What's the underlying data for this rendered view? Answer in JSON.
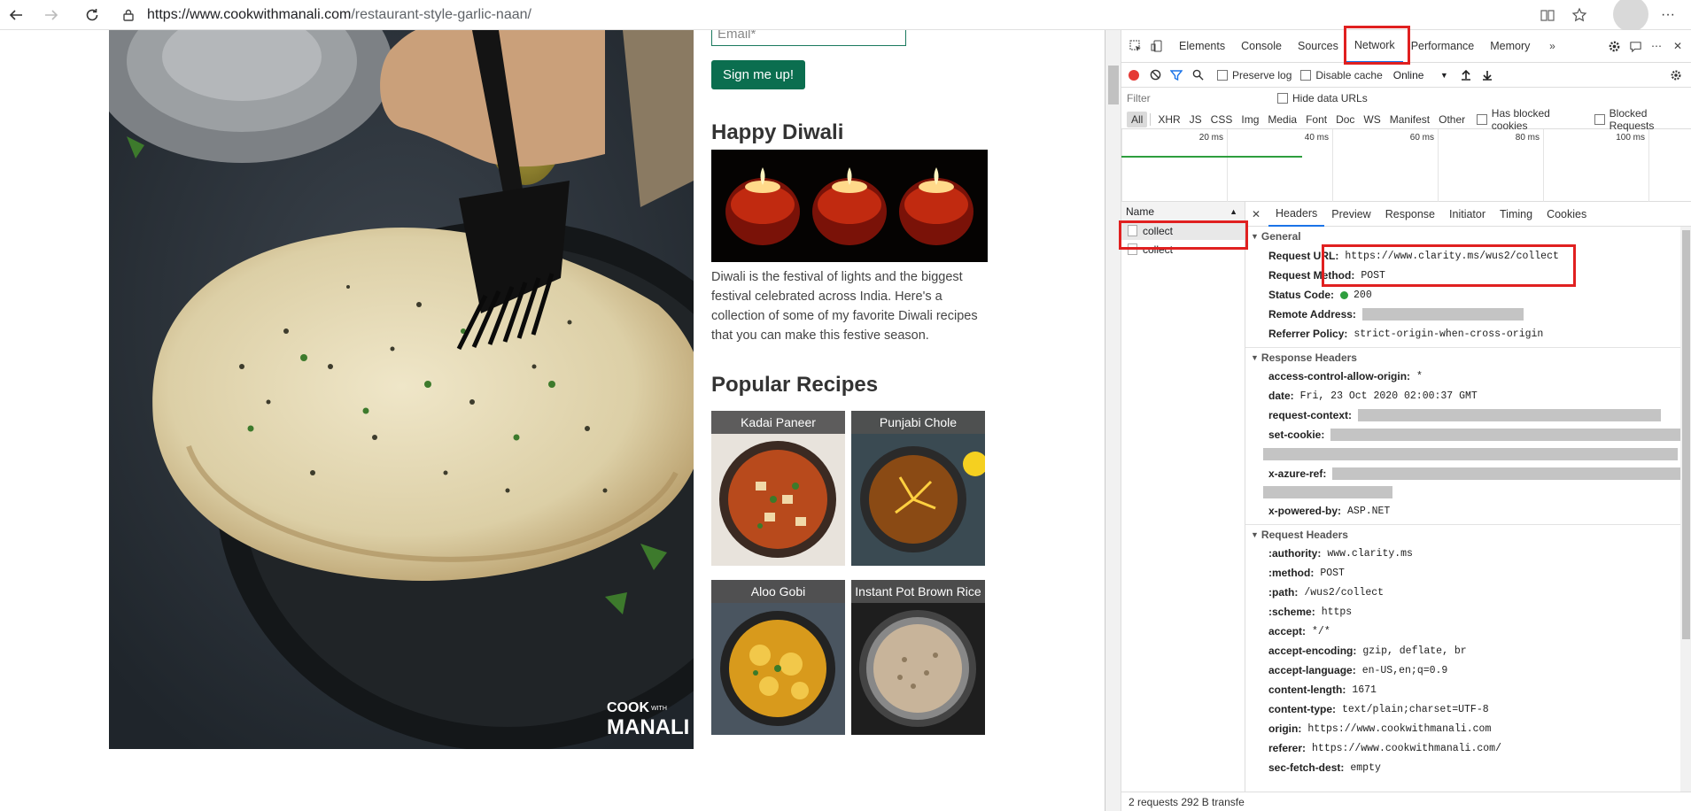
{
  "browser": {
    "url_domain": "https://www.cookwithmanali.com",
    "url_path": "/restaurant-style-garlic-naan/"
  },
  "page": {
    "email_placeholder": "Email*",
    "signup_label": "Sign me up!",
    "diwali_heading": "Happy Diwali",
    "diwali_text": "Diwali is the festival of lights and the biggest festival celebrated across India. Here's a collection of some of my favorite Diwali recipes that you can make this festive season.",
    "popular_heading": "Popular Recipes",
    "recipes": [
      {
        "label": "Kadai Paneer"
      },
      {
        "label": "Punjabi Chole"
      },
      {
        "label": "Aloo Gobi"
      },
      {
        "label": "Instant Pot Brown Rice"
      }
    ],
    "logo_text": "COOK WITH MANALI"
  },
  "devtools": {
    "tabs": [
      "Elements",
      "Console",
      "Sources",
      "Network",
      "Performance",
      "Memory"
    ],
    "active_tab": "Network",
    "toolbar": {
      "preserve_log": "Preserve log",
      "disable_cache": "Disable cache",
      "throttle": "Online"
    },
    "filter": {
      "placeholder": "Filter",
      "hide_data_urls": "Hide data URLs",
      "types": [
        "All",
        "XHR",
        "JS",
        "CSS",
        "Img",
        "Media",
        "Font",
        "Doc",
        "WS",
        "Manifest",
        "Other"
      ],
      "has_blocked_cookies": "Has blocked cookies",
      "blocked_requests": "Blocked Requests"
    },
    "timeline_ticks": [
      "20 ms",
      "40 ms",
      "60 ms",
      "80 ms",
      "100 ms"
    ],
    "requests": {
      "name_header": "Name",
      "rows": [
        "collect",
        "collect"
      ]
    },
    "detail_tabs": [
      "Headers",
      "Preview",
      "Response",
      "Initiator",
      "Timing",
      "Cookies"
    ],
    "general": {
      "title": "General",
      "request_url_key": "Request URL:",
      "request_url": "https://www.clarity.ms/wus2/collect",
      "request_method_key": "Request Method:",
      "request_method": "POST",
      "status_code_key": "Status Code:",
      "status_code": "200",
      "remote_address_key": "Remote Address:",
      "referrer_policy_key": "Referrer Policy:",
      "referrer_policy": "strict-origin-when-cross-origin"
    },
    "response_headers": {
      "title": "Response Headers",
      "items": [
        {
          "k": "access-control-allow-origin:",
          "v": "*"
        },
        {
          "k": "date:",
          "v": "Fri, 23 Oct 2020 02:00:37 GMT"
        },
        {
          "k": "request-context:",
          "v": ""
        },
        {
          "k": "set-cookie:",
          "v": ""
        },
        {
          "k": "x-azure-ref:",
          "v": ""
        },
        {
          "k": "x-powered-by:",
          "v": "ASP.NET"
        }
      ]
    },
    "request_headers": {
      "title": "Request Headers",
      "items": [
        {
          "k": ":authority:",
          "v": "www.clarity.ms"
        },
        {
          "k": ":method:",
          "v": "POST"
        },
        {
          "k": ":path:",
          "v": "/wus2/collect"
        },
        {
          "k": ":scheme:",
          "v": "https"
        },
        {
          "k": "accept:",
          "v": "*/*"
        },
        {
          "k": "accept-encoding:",
          "v": "gzip, deflate, br"
        },
        {
          "k": "accept-language:",
          "v": "en-US,en;q=0.9"
        },
        {
          "k": "content-length:",
          "v": "1671"
        },
        {
          "k": "content-type:",
          "v": "text/plain;charset=UTF-8"
        },
        {
          "k": "origin:",
          "v": "https://www.cookwithmanali.com"
        },
        {
          "k": "referer:",
          "v": "https://www.cookwithmanali.com/"
        },
        {
          "k": "sec-fetch-dest:",
          "v": "empty"
        }
      ]
    },
    "status_bar": "2 requests  292 B transfe"
  },
  "colors": {
    "accent": "#1a73e8",
    "signup_green": "#0b6e4f",
    "highlight_red": "#e02020",
    "record_red": "#e53935",
    "status_green": "#2e9e3e"
  }
}
